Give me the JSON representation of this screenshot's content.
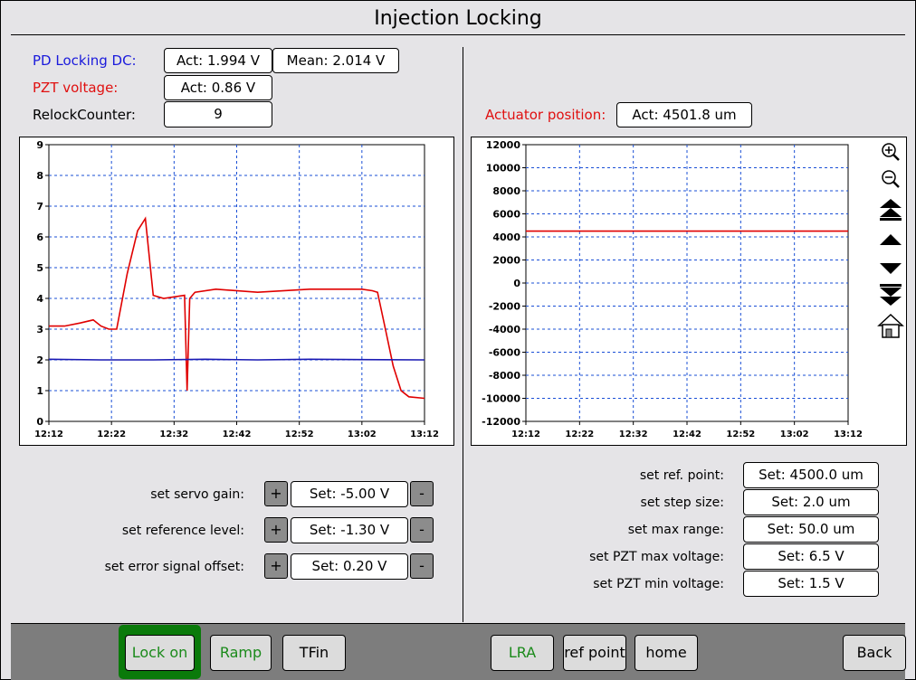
{
  "window": {
    "title": "Injection Locking"
  },
  "readouts": {
    "pd_locking_dc": {
      "label": "PD Locking DC:",
      "act": "Act: 1.994 V",
      "mean": "Mean: 2.014 V"
    },
    "pzt_voltage": {
      "label": "PZT voltage:",
      "act": "Act: 0.86 V"
    },
    "relock_counter": {
      "label": "RelockCounter:",
      "value": "9"
    },
    "actuator_position": {
      "label": "Actuator position:",
      "act": "Act: 4501.8 um"
    }
  },
  "left_chart": {
    "y_ticks": [
      "0",
      "1",
      "2",
      "3",
      "4",
      "5",
      "6",
      "7",
      "8",
      "9"
    ],
    "x_ticks": [
      "12:12",
      "12:22",
      "12:32",
      "12:42",
      "12:52",
      "13:02",
      "13:12"
    ]
  },
  "right_chart": {
    "y_ticks": [
      "-12000",
      "-10000",
      "-8000",
      "-6000",
      "-4000",
      "-2000",
      "0",
      "2000",
      "4000",
      "6000",
      "8000",
      "10000",
      "12000"
    ],
    "x_ticks": [
      "12:12",
      "12:22",
      "12:32",
      "12:42",
      "12:52",
      "13:02",
      "13:12"
    ]
  },
  "chart_data": [
    {
      "type": "line",
      "x": [
        "12:12",
        "12:22",
        "12:32",
        "12:42",
        "12:52",
        "13:02",
        "13:12"
      ],
      "xlim": [
        "12:12",
        "13:12"
      ],
      "ylim": [
        0,
        9
      ],
      "grid": true,
      "series": [
        {
          "color": "#e00000",
          "points": [
            [
              0,
              3.1
            ],
            [
              3,
              3.1
            ],
            [
              6,
              3.2
            ],
            [
              8.5,
              3.3
            ],
            [
              10,
              3.1
            ],
            [
              11.5,
              3.0
            ],
            [
              13,
              3.0
            ],
            [
              15,
              4.8
            ],
            [
              17,
              6.2
            ],
            [
              18.5,
              6.6
            ],
            [
              20,
              4.1
            ],
            [
              22,
              4.0
            ],
            [
              26,
              4.1
            ],
            [
              26.5,
              1.0
            ],
            [
              27,
              4.0
            ],
            [
              28,
              4.2
            ],
            [
              32,
              4.3
            ],
            [
              40,
              4.2
            ],
            [
              50,
              4.3
            ],
            [
              60,
              4.3
            ],
            [
              62,
              4.25
            ],
            [
              63,
              4.2
            ],
            [
              64.5,
              3.0
            ],
            [
              66,
              1.8
            ],
            [
              67.5,
              1.0
            ],
            [
              69,
              0.8
            ],
            [
              72,
              0.75
            ]
          ]
        },
        {
          "color": "#1a1ab4",
          "points": [
            [
              0,
              2.02
            ],
            [
              10,
              2.0
            ],
            [
              20,
              2.0
            ],
            [
              30,
              2.02
            ],
            [
              40,
              2.0
            ],
            [
              50,
              2.02
            ],
            [
              60,
              2.01
            ],
            [
              72,
              2.0
            ]
          ]
        }
      ]
    },
    {
      "type": "line",
      "x": [
        "12:12",
        "12:22",
        "12:32",
        "12:42",
        "12:52",
        "13:02",
        "13:12"
      ],
      "xlim": [
        "12:12",
        "13:12"
      ],
      "ylim": [
        -12000,
        12000
      ],
      "grid": true,
      "series": [
        {
          "color": "#e00000",
          "points": [
            [
              0,
              4500
            ],
            [
              60,
              4500
            ]
          ]
        }
      ]
    }
  ],
  "controls_left": [
    {
      "label": "set servo gain:",
      "value": "Set: -5.00 V",
      "plus": "+",
      "minus": "-"
    },
    {
      "label": "set reference level:",
      "value": "Set: -1.30  V",
      "plus": "+",
      "minus": "-"
    },
    {
      "label": "set error signal offset:",
      "value": "Set: 0.20 V",
      "plus": "+",
      "minus": "-"
    }
  ],
  "controls_right": [
    {
      "label": "set ref. point:",
      "value": "Set: 4500.0 um"
    },
    {
      "label": "set step size:",
      "value": "Set: 2.0 um"
    },
    {
      "label": "set max range:",
      "value": "Set: 50.0 um"
    },
    {
      "label": "set PZT max voltage:",
      "value": "Set: 6.5 V"
    },
    {
      "label": "set PZT min voltage:",
      "value": "Set: 1.5 V"
    }
  ],
  "nav_icons": [
    "zoom-in-icon",
    "zoom-out-icon",
    "fast-up-icon",
    "up-icon",
    "down-icon",
    "fast-down-icon",
    "home-icon"
  ],
  "bottom_buttons": {
    "lock_on": "Lock on",
    "ramp": "Ramp",
    "tfin": "TFin",
    "lra": "LRA",
    "ref_point": "ref point",
    "home": "home",
    "back": "Back"
  },
  "colors": {
    "accent_green": "#1a8a1a",
    "label_red": "#e01010",
    "label_blue": "#1a1adc",
    "selected_border": "#0a7a0a"
  }
}
